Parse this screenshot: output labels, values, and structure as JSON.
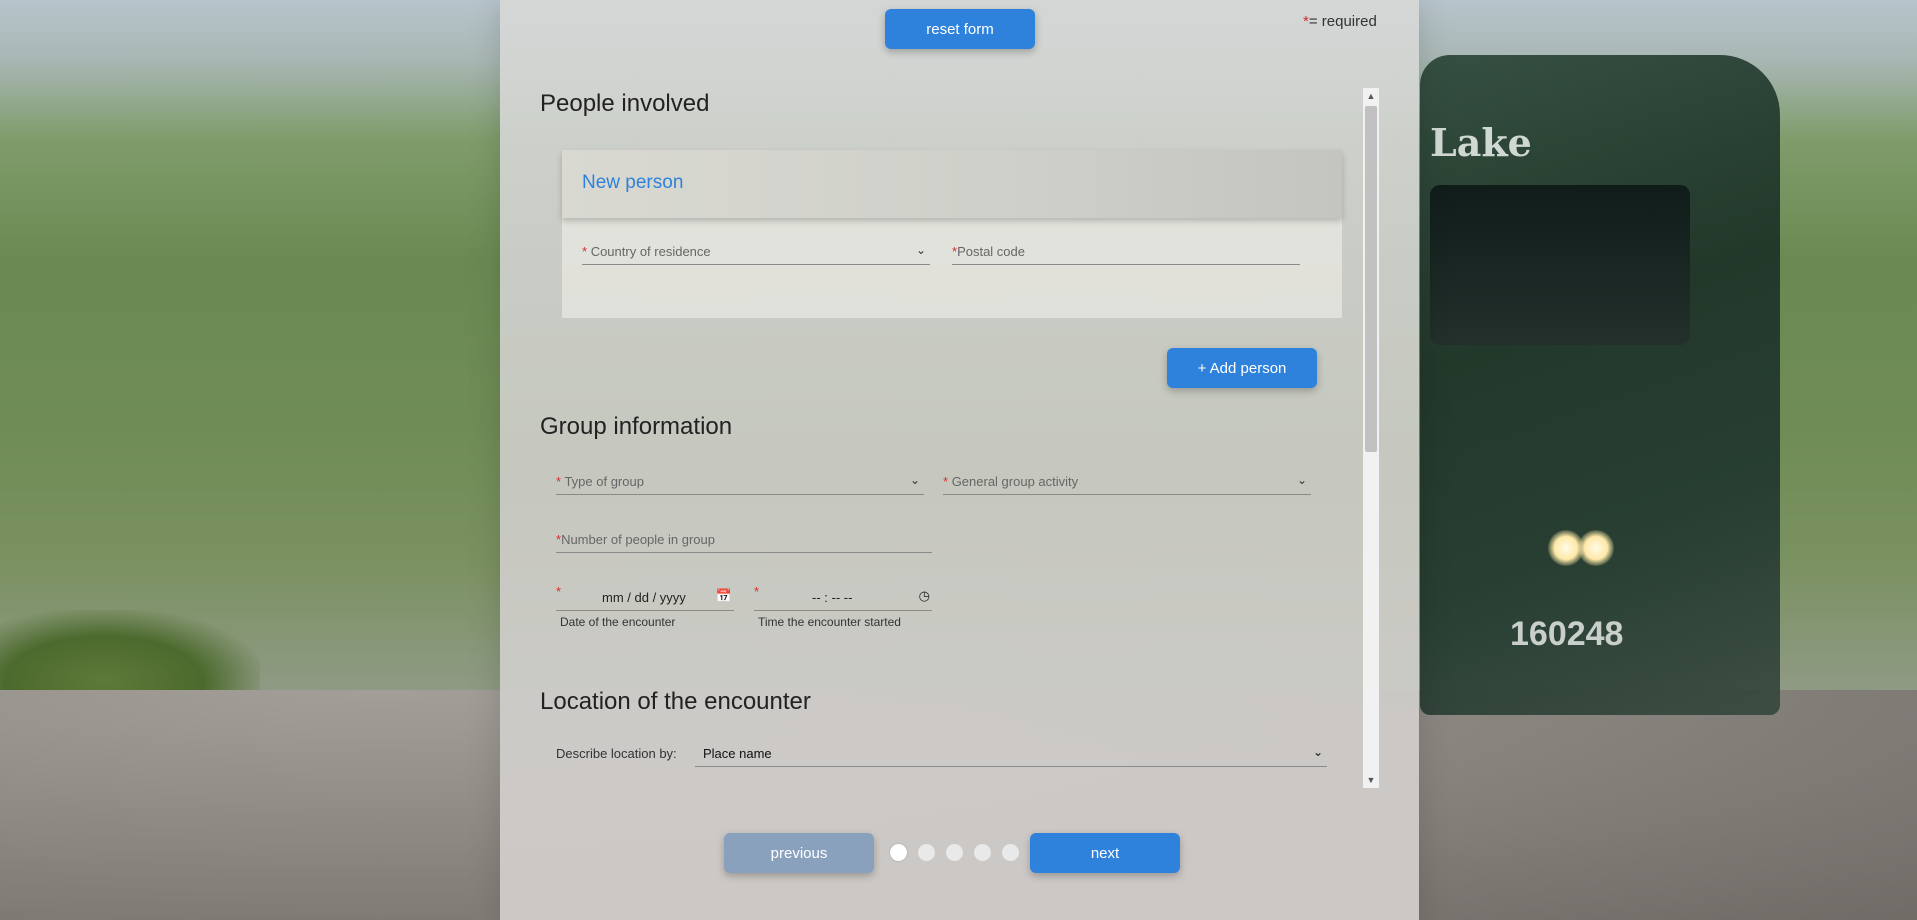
{
  "background": {
    "bus_sign": "Lake",
    "bus_number": "160248"
  },
  "header": {
    "reset_label": "reset form",
    "required_star": "*",
    "required_text": "= required"
  },
  "people": {
    "title": "People involved",
    "card_title": "New person",
    "country_label": "Country of residence",
    "postal_label": "Postal code",
    "add_person_label": "+ Add person"
  },
  "group": {
    "title": "Group information",
    "type_label": "Type of group",
    "activity_label": "General group activity",
    "number_label": "Number of people in group",
    "date_placeholder": "mm / dd / yyyy",
    "date_helper": "Date of the encounter",
    "time_placeholder": "-- : -- --",
    "time_helper": "Time the encounter started"
  },
  "location": {
    "title": "Location of the encounter",
    "describe_label": "Describe location by:",
    "describe_value": "Place name"
  },
  "nav": {
    "previous_label": "previous",
    "next_label": "next",
    "step_count": 5,
    "current_step": 1
  },
  "colors": {
    "accent": "#2f82db",
    "required": "#d32f2f",
    "prev_button": "#8aa1bd"
  },
  "icons": {
    "chevron": "chevron-down-icon",
    "calendar": "calendar-icon",
    "clock": "clock-icon"
  }
}
